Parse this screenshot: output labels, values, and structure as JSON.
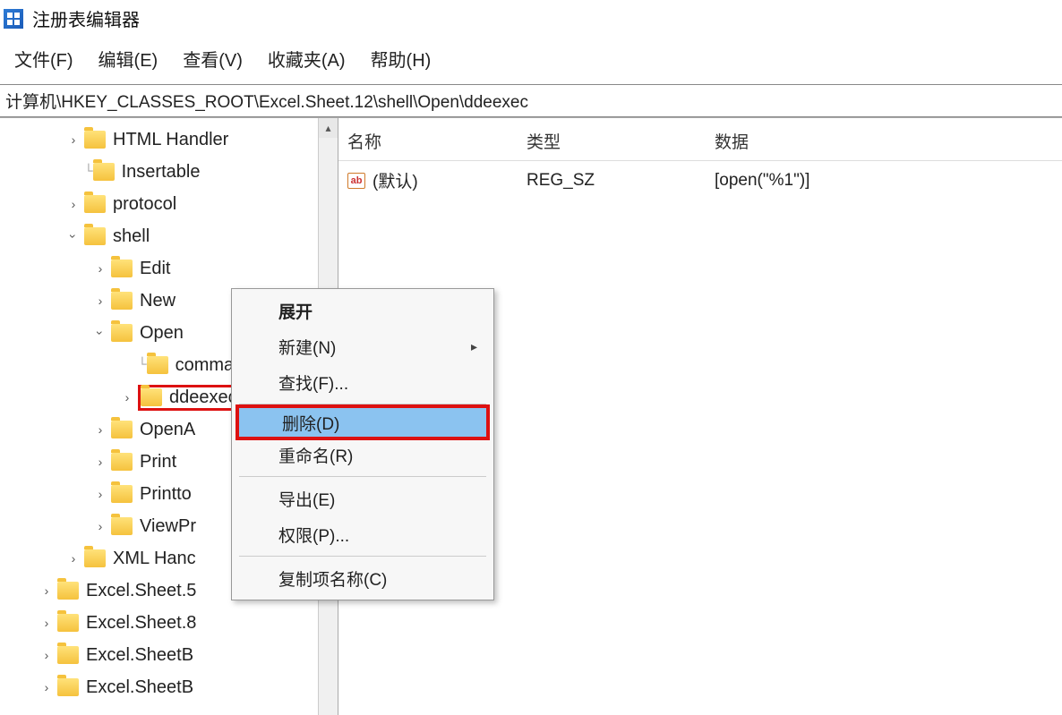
{
  "window": {
    "title": "注册表编辑器"
  },
  "menu": {
    "file": "文件(F)",
    "edit": "编辑(E)",
    "view": "查看(V)",
    "fav": "收藏夹(A)",
    "help": "帮助(H)"
  },
  "address": "计算机\\HKEY_CLASSES_ROOT\\Excel.Sheet.12\\shell\\Open\\ddeexec",
  "tree": {
    "n0": "HTML Handler",
    "n1": "Insertable",
    "n2": "protocol",
    "n3": "shell",
    "n4": "Edit",
    "n5": "New",
    "n6": "Open",
    "n7": "command",
    "n8": "ddeexec",
    "n9": "OpenA",
    "n10": "Print",
    "n11": "Printto",
    "n12": "ViewPr",
    "n13": "XML Hanc",
    "n14": "Excel.Sheet.5",
    "n15": "Excel.Sheet.8",
    "n16": "Excel.SheetB",
    "n17": "Excel.SheetB"
  },
  "values": {
    "head_name": "名称",
    "head_type": "类型",
    "head_data": "数据",
    "row0_name": "(默认)",
    "row0_type": "REG_SZ",
    "row0_data": "[open(\"%1\")]"
  },
  "ctx": {
    "expand": "展开",
    "new": "新建(N)",
    "find": "查找(F)...",
    "delete": "删除(D)",
    "rename": "重命名(R)",
    "export": "导出(E)",
    "perm": "权限(P)...",
    "copyname": "复制项名称(C)"
  }
}
